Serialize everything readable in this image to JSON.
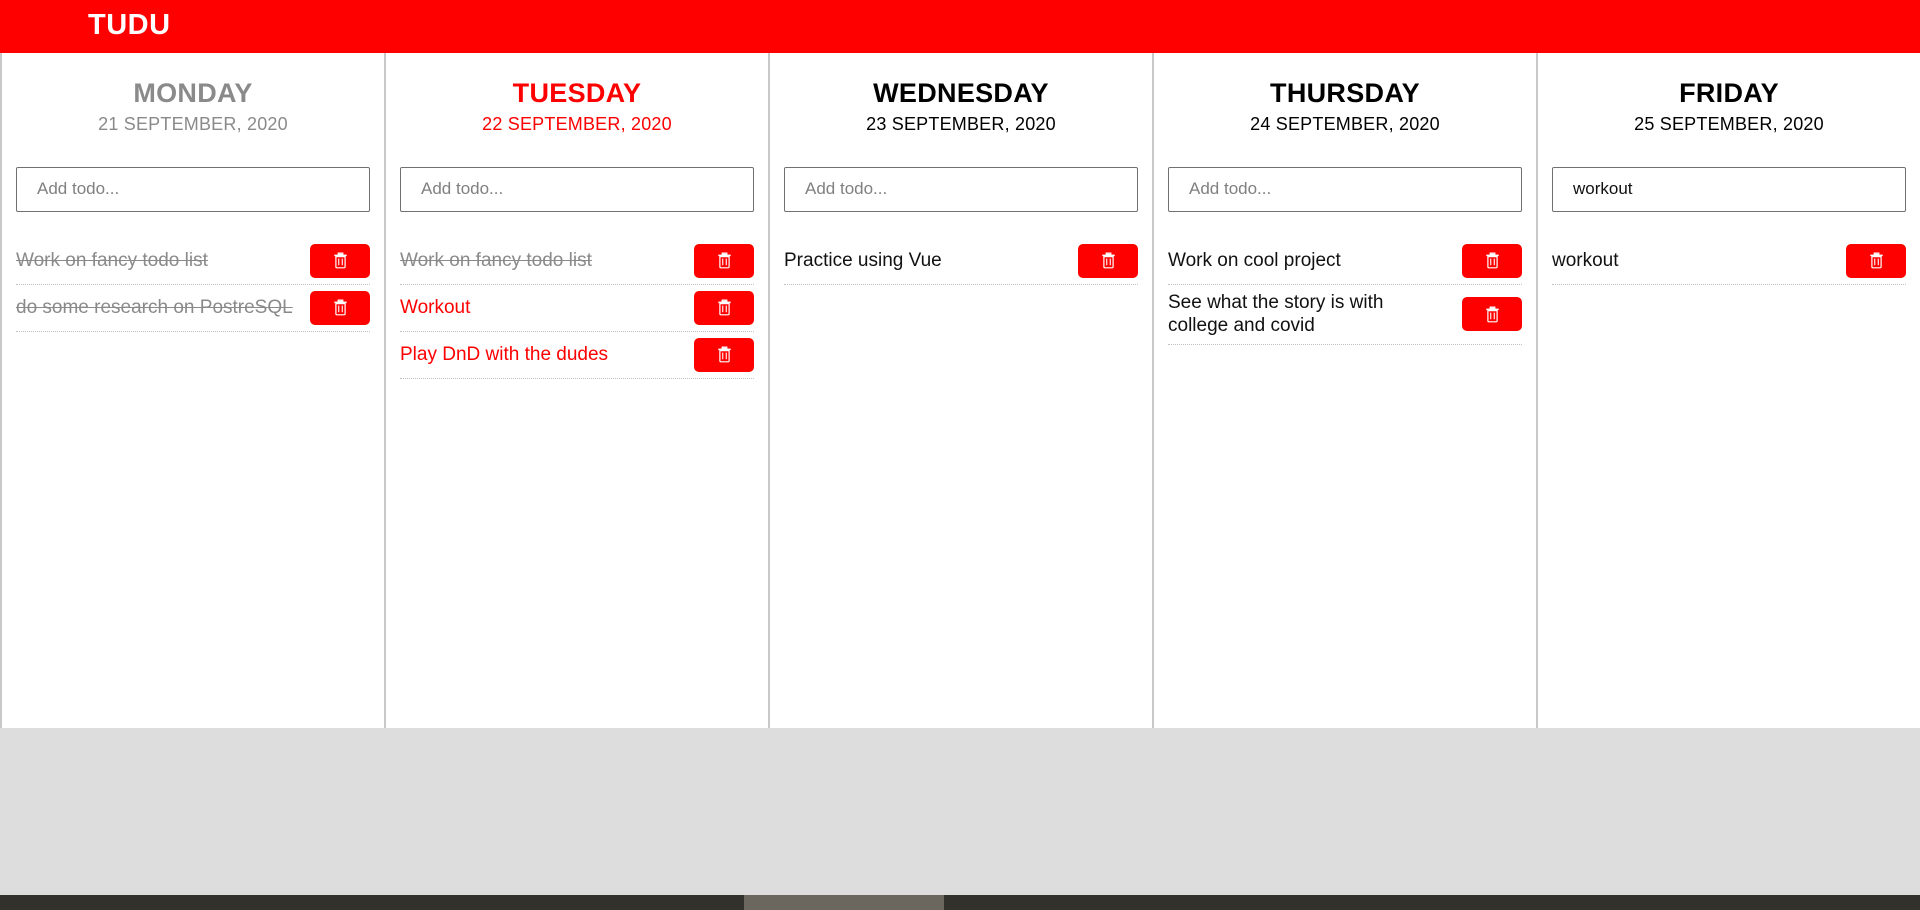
{
  "header": {
    "title": "TUDU",
    "background_color": "#fe0000",
    "text_color": "#ffffff"
  },
  "theme": {
    "accent_color": "#fe0000",
    "past_day_color": "#8a8a8a",
    "default_text_color": "#111111",
    "divider_color": "#c9c9c9"
  },
  "icons": {
    "delete": "trash-icon"
  },
  "days": [
    {
      "name": "MONDAY",
      "date": "21 SEPTEMBER, 2020",
      "state": "past",
      "input": {
        "value": "",
        "placeholder": "Add todo..."
      },
      "todos": [
        {
          "text": "Work on fancy todo list",
          "done": true
        },
        {
          "text": "do some research on PostreSQL",
          "done": true
        }
      ]
    },
    {
      "name": "TUESDAY",
      "date": "22 SEPTEMBER, 2020",
      "state": "today",
      "input": {
        "value": "",
        "placeholder": "Add todo..."
      },
      "todos": [
        {
          "text": "Work on fancy todo list",
          "done": true
        },
        {
          "text": "Workout",
          "done": false
        },
        {
          "text": "Play DnD with the dudes",
          "done": false
        }
      ]
    },
    {
      "name": "WEDNESDAY",
      "date": "23 SEPTEMBER, 2020",
      "state": "future",
      "input": {
        "value": "",
        "placeholder": "Add todo..."
      },
      "todos": [
        {
          "text": "Practice using Vue",
          "done": false
        }
      ]
    },
    {
      "name": "THURSDAY",
      "date": "24 SEPTEMBER, 2020",
      "state": "future",
      "input": {
        "value": "",
        "placeholder": "Add todo..."
      },
      "todos": [
        {
          "text": "Work on cool project",
          "done": false
        },
        {
          "text": "See what the story is with college and covid",
          "done": false
        }
      ]
    },
    {
      "name": "FRIDAY",
      "date": "25 SEPTEMBER, 2020",
      "state": "future",
      "input": {
        "value": "workout",
        "placeholder": "Add todo..."
      },
      "todos": [
        {
          "text": "workout",
          "done": false
        }
      ]
    }
  ]
}
